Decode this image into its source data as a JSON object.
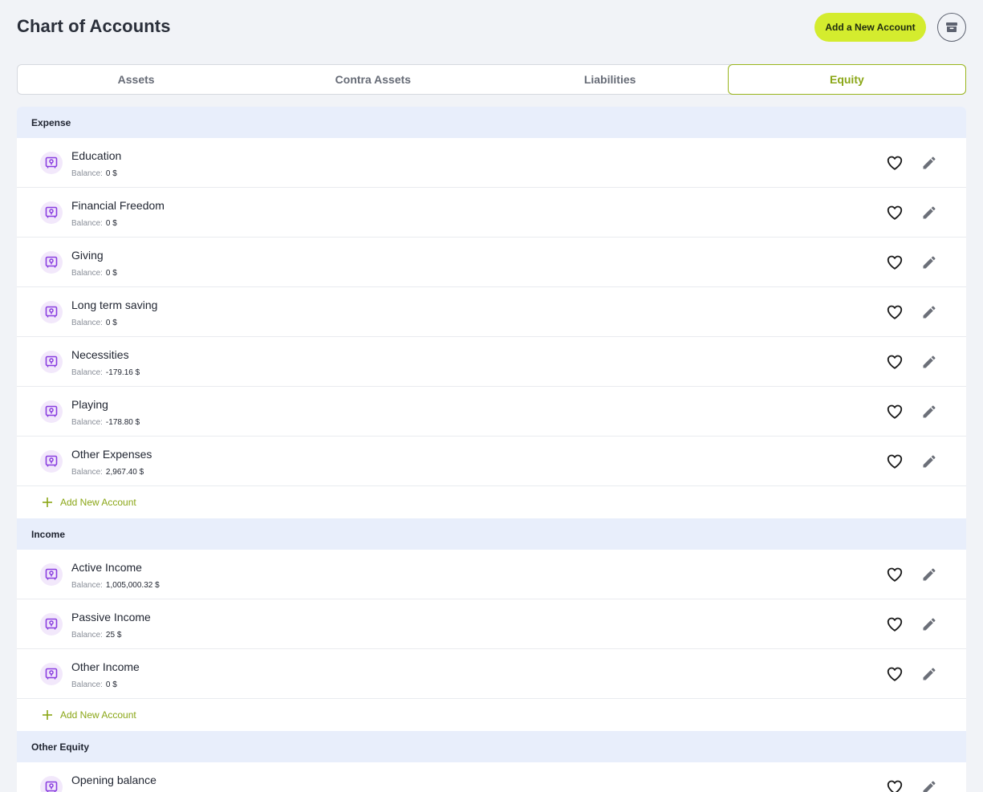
{
  "page": {
    "title": "Chart of Accounts"
  },
  "toolbar": {
    "add_label": "Add a New Account",
    "archive_icon": "archive-icon"
  },
  "tabs": [
    {
      "label": "Assets",
      "active": false
    },
    {
      "label": "Contra Assets",
      "active": false
    },
    {
      "label": "Liabilities",
      "active": false
    },
    {
      "label": "Equity",
      "active": true
    }
  ],
  "colors": {
    "accent": "#d4ec2e",
    "accent_text": "#8aa616",
    "group_header_bg": "#e8eefb",
    "account_icon": "#8a3ee0"
  },
  "balance_label": "Balance:",
  "add_account_label": "Add New Account",
  "groups": [
    {
      "name": "Expense",
      "accounts": [
        {
          "name": "Education",
          "balance": "0 $"
        },
        {
          "name": "Financial Freedom",
          "balance": "0 $"
        },
        {
          "name": "Giving",
          "balance": "0 $"
        },
        {
          "name": "Long term saving",
          "balance": "0 $"
        },
        {
          "name": "Necessities",
          "balance": "-179.16 $"
        },
        {
          "name": "Playing",
          "balance": "-178.80 $"
        },
        {
          "name": "Other Expenses",
          "balance": "2,967.40 $"
        }
      ]
    },
    {
      "name": "Income",
      "accounts": [
        {
          "name": "Active Income",
          "balance": "1,005,000.32 $"
        },
        {
          "name": "Passive Income",
          "balance": "25 $"
        },
        {
          "name": "Other Income",
          "balance": "0 $"
        }
      ]
    },
    {
      "name": "Other Equity",
      "accounts": [
        {
          "name": "Opening balance",
          "balance": ""
        }
      ]
    }
  ]
}
